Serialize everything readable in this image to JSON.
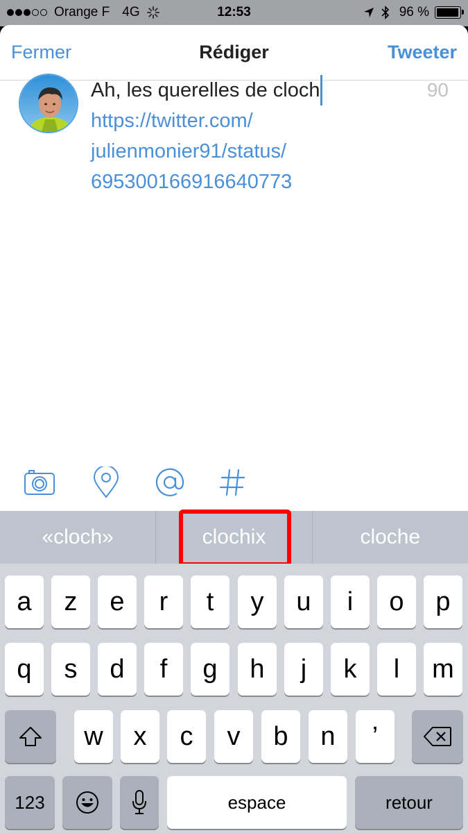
{
  "status_bar": {
    "carrier": "Orange F",
    "network": "4G",
    "time": "12:53",
    "battery_percent": "96 %",
    "battery_level": 0.96
  },
  "nav": {
    "close_label": "Fermer",
    "title": "Rédiger",
    "tweet_label": "Tweeter"
  },
  "compose": {
    "text": "Ah, les querelles de cloch",
    "link_lines": [
      "https://twitter.com/",
      "julienmonier91/status/",
      "695300166916640773"
    ],
    "char_count": "90"
  },
  "toolbar": {
    "icons": [
      "camera-icon",
      "location-pin-icon",
      "mention-icon",
      "hashtag-icon"
    ],
    "accent_color": "#4a90d9"
  },
  "suggestions": [
    "«cloch»",
    "clochix",
    "cloche"
  ],
  "highlight_color": "#ff0000",
  "keyboard": {
    "row1": [
      "a",
      "z",
      "e",
      "r",
      "t",
      "y",
      "u",
      "i",
      "o",
      "p"
    ],
    "row2": [
      "q",
      "s",
      "d",
      "f",
      "g",
      "h",
      "j",
      "k",
      "l",
      "m"
    ],
    "row3": [
      "w",
      "x",
      "c",
      "v",
      "b",
      "n",
      "’"
    ],
    "numbers_label": "123",
    "space_label": "espace",
    "return_label": "retour"
  }
}
